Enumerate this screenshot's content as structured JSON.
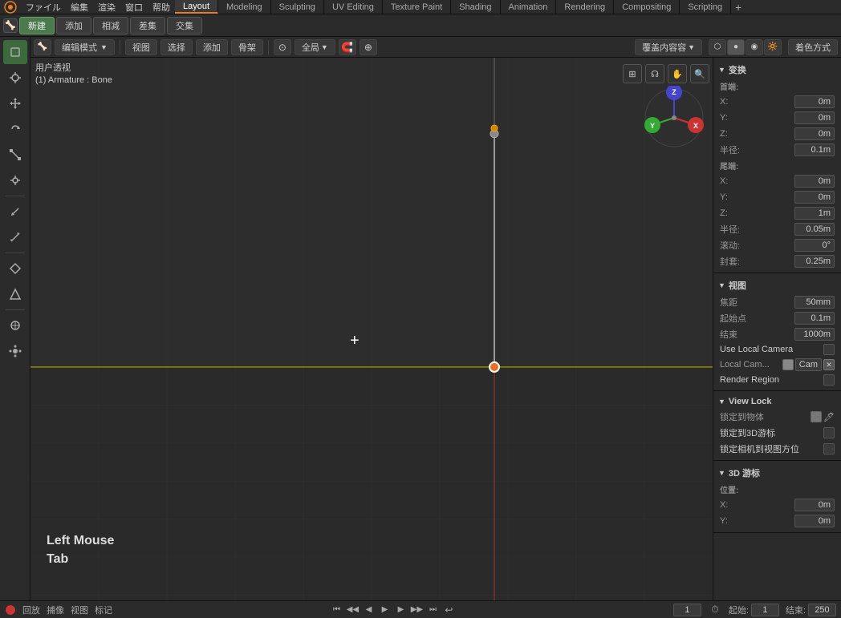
{
  "app": {
    "title": "Blender"
  },
  "top_menu": {
    "items": [
      "Blender",
      "ファイル",
      "編集",
      "渲染",
      "窗口",
      "帮助"
    ],
    "blender_icon": "⬡"
  },
  "workspace_tabs": [
    {
      "label": "Layout",
      "active": true
    },
    {
      "label": "Modeling",
      "active": false
    },
    {
      "label": "Sculpting",
      "active": false
    },
    {
      "label": "UV Editing",
      "active": false
    },
    {
      "label": "Texture Paint",
      "active": false
    },
    {
      "label": "Shading",
      "active": false
    },
    {
      "label": "Animation",
      "active": false
    },
    {
      "label": "Rendering",
      "active": false
    },
    {
      "label": "Compositing",
      "active": false
    },
    {
      "label": "Scripting",
      "active": false
    }
  ],
  "toolbar": {
    "new_label": "新建",
    "add_label": "添加",
    "subtract_label": "相减",
    "difference_label": "差集",
    "intersect_label": "交集"
  },
  "viewport_header": {
    "mode_label": "编辑模式",
    "view_label": "视图",
    "select_label": "选择",
    "add_label": "添加",
    "bone_label": "骨架",
    "global_label": "全局",
    "cursor_icon": "⊕",
    "overlay_label": "覆盖内容容",
    "shading_label": "着色方式"
  },
  "viewport_info": {
    "view_type": "用户透视",
    "object_info": "(1) Armature : Bone"
  },
  "left_toolbar": {
    "tools": [
      {
        "name": "select-box",
        "icon": "⬜",
        "active": true
      },
      {
        "name": "cursor",
        "icon": "⊕"
      },
      {
        "name": "move",
        "icon": "✛"
      },
      {
        "name": "rotate",
        "icon": "↻"
      },
      {
        "name": "scale",
        "icon": "⤡"
      },
      {
        "name": "transform",
        "icon": "⟲"
      },
      {
        "name": "separator1"
      },
      {
        "name": "annotate",
        "icon": "✏"
      },
      {
        "name": "measure",
        "icon": "📏"
      },
      {
        "name": "separator2"
      },
      {
        "name": "tool1",
        "icon": "⊿"
      },
      {
        "name": "tool2",
        "icon": "⟁"
      },
      {
        "name": "separator3"
      },
      {
        "name": "tool3",
        "icon": "✳"
      },
      {
        "name": "tool4",
        "icon": "⊕"
      }
    ]
  },
  "right_panel": {
    "sections": [
      {
        "name": "transform",
        "label": "变换",
        "subsections": [
          {
            "name": "head",
            "label": "首端:",
            "fields": [
              {
                "label": "X:",
                "value": "0m"
              },
              {
                "label": "Y:",
                "value": "0m"
              },
              {
                "label": "Z:",
                "value": "0m"
              },
              {
                "label": "半径:",
                "value": "0.1m"
              }
            ]
          },
          {
            "name": "tail",
            "label": "尾端:",
            "fields": [
              {
                "label": "X:",
                "value": "0m"
              },
              {
                "label": "Y:",
                "value": "0m"
              },
              {
                "label": "Z:",
                "value": "1m"
              },
              {
                "label": "半径:",
                "value": "0.05m"
              }
            ]
          },
          {
            "name": "roll",
            "fields_single": [
              {
                "label": "滚动:",
                "value": "0°"
              },
              {
                "label": "封套:",
                "value": "0.25m"
              }
            ]
          }
        ]
      },
      {
        "name": "view",
        "label": "视图",
        "fields": [
          {
            "label": "焦距",
            "value": "50mm"
          },
          {
            "label": "起始点",
            "value": "0.1m"
          },
          {
            "label": "结束",
            "value": "1000m"
          }
        ],
        "checkboxes": [
          {
            "label": "Use Local Camera",
            "checked": false
          },
          {
            "label": "Local Cam...",
            "value": "Cam",
            "has_x": true
          },
          {
            "label": "Render Region",
            "checked": false
          }
        ]
      },
      {
        "name": "view_lock",
        "label": "View Lock",
        "fields": [
          {
            "label": "锁定到物体",
            "has_color": true,
            "has_eyedropper": true
          },
          {
            "label": "锁定到3D游标",
            "checked": false
          },
          {
            "label": "锁定相机到视图方位",
            "checked": false
          }
        ]
      },
      {
        "name": "cursor_3d",
        "label": "3D 游标",
        "fields": [
          {
            "label": "位置:"
          },
          {
            "label": "X:",
            "value": "0m"
          },
          {
            "label": "Y:",
            "value": "0m"
          }
        ]
      }
    ]
  },
  "mouse_hint": {
    "line1": "Left Mouse",
    "line2": "Tab"
  },
  "status_bar": {
    "engine_icon": "🔴",
    "playback_label": "回放",
    "capture_label": "捕像",
    "view_label": "视图",
    "marker_label": "标记",
    "frame_current": "1",
    "clock_icon": "🕐",
    "start_label": "起始:",
    "start_value": "1",
    "end_label": "结束:",
    "end_value": "250"
  },
  "timeline_controls": {
    "first_btn": "⏮",
    "prev_btn": "◀",
    "prev_frame": "◀",
    "play_btn": "▶",
    "next_frame": "▶",
    "last_btn": "⏭",
    "loop_btn": "↩"
  },
  "colors": {
    "bg": "#2a2a2a",
    "panel_bg": "#2b2b2b",
    "accent_orange": "#e88020",
    "grid_color": "#3a3a3a",
    "axis_x": "#cc3333",
    "axis_y": "#4aa34a",
    "axis_z": "#3333cc",
    "ground_yellow": "#9a9a00"
  }
}
